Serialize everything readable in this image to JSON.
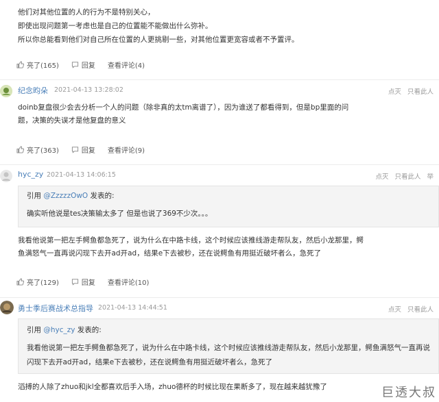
{
  "comment0": {
    "lines": [
      "他们对其他位置的人的行为不是特别关心，",
      "即使出现问题第一考虑也是自己的位置能不能做出什么弥补。",
      "所以你总能看到他们对自己所在位置的人更挑剔一些，对其他位置更宽容或者不予置评。"
    ],
    "like": "亮了(165)",
    "reply": "回复",
    "view_replies": "查看评论(4)"
  },
  "comment1": {
    "username": "纪念昀朵",
    "time": "2021-04-13 13:28:02",
    "lines": [
      "doinb复盘很少会去分析一个人的问题（除非真的太tm离谱了），因为谁送了都看得到，但是bp里面的问",
      "题，决策的失误才是他复盘的意义"
    ],
    "like": "亮了(363)",
    "reply": "回复",
    "view_replies": "查看评论(9)"
  },
  "comment2": {
    "username": "hyc_zy",
    "time": "2021-04-13 14:06:15",
    "quote_prefix": "引用 ",
    "quote_user": "@ZzzzzOwO",
    "quote_suffix": " 发表的:",
    "quote_text": "确实听他说是tes决策输太多了 但是也说了369不少次。。。",
    "lines": [
      "我看他说第一把左手鳄鱼都急死了，说为什么在中路卡线，这个时候应该推线游走帮队友，然后小龙那里，鳄",
      "鱼满怒气一直再说闪现下去开ad开ad，结果e下去被秒，还在说鳄鱼有用挺近破坏者么，急死了"
    ],
    "like": "亮了(129)",
    "reply": "回复",
    "view_replies": "查看评论(10)"
  },
  "comment3": {
    "username": "勇士季后赛战术总指导",
    "time": "2021-04-13 14:44:51",
    "quote_prefix": "引用 ",
    "quote_user": "@hyc_zy",
    "quote_suffix": " 发表的:",
    "quote_lines": [
      "我看他说第一把左手鳄鱼都急死了，说为什么在中路卡线，这个时候应该推线游走帮队友，然后小龙那里，鳄鱼满怒气一直再说",
      "闪现下去开ad开ad，结果e下去被秒，还在说鳄鱼有用挺近破坏者么，急死了"
    ],
    "lines": [
      "滔搏的人除了zhuo和jkl全都喜欢后手入场，zhuo德杯的时候比现在果断多了，现在越来越犹豫了"
    ]
  },
  "common": {
    "rt_light": "点灭",
    "rt_only": "只看此人",
    "rt_report": "举"
  },
  "watermark": "巨透大叔"
}
